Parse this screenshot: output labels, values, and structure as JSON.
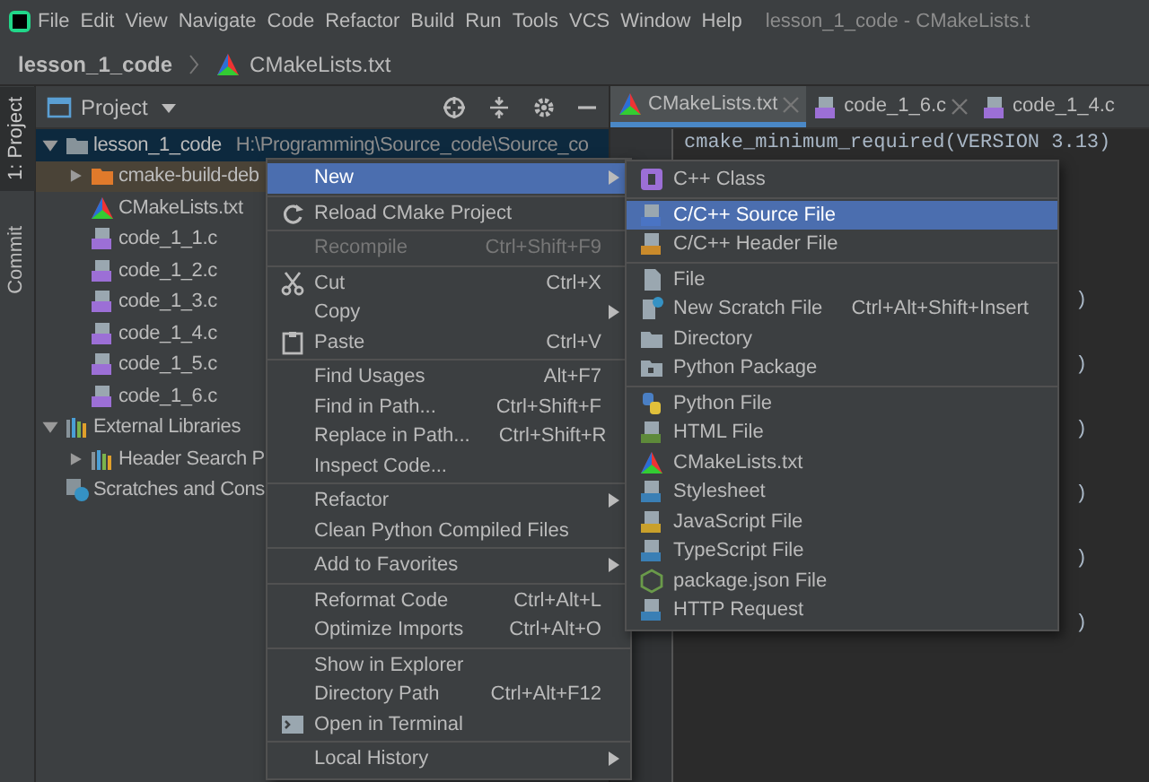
{
  "menu_bar": {
    "items": [
      "File",
      "Edit",
      "View",
      "Navigate",
      "Code",
      "Refactor",
      "Build",
      "Run",
      "Tools",
      "VCS",
      "Window",
      "Help"
    ],
    "title": "lesson_1_code - CMakeLists.t"
  },
  "breadcrumb": {
    "project": "lesson_1_code",
    "file": "CMakeLists.txt"
  },
  "side_strip": {
    "tabs": [
      {
        "label": "1: Project",
        "selected": true
      },
      {
        "label": "Commit",
        "selected": false
      }
    ]
  },
  "project_panel": {
    "title": "Project",
    "tree": [
      {
        "kind": "folder",
        "name": "lesson_1_code",
        "path": "H:\\Programming\\Source_code\\Source_co",
        "expanded": true,
        "selected": true,
        "children": [
          {
            "kind": "excluded-folder",
            "name": "cmake-build-deb",
            "expanded": false,
            "selected": false
          },
          {
            "kind": "cmake",
            "name": "CMakeLists.txt",
            "selected": false
          },
          {
            "kind": "c-file",
            "name": "code_1_1.c",
            "selected": false
          },
          {
            "kind": "c-file",
            "name": "code_1_2.c",
            "selected": false
          },
          {
            "kind": "c-file",
            "name": "code_1_3.c",
            "selected": false
          },
          {
            "kind": "c-file",
            "name": "code_1_4.c",
            "selected": false
          },
          {
            "kind": "c-file",
            "name": "code_1_5.c",
            "selected": false
          },
          {
            "kind": "c-file",
            "name": "code_1_6.c",
            "selected": false
          }
        ]
      },
      {
        "kind": "library",
        "name": "External Libraries",
        "expanded": true,
        "selected": false,
        "children": [
          {
            "kind": "library",
            "name": "Header Search P",
            "expanded": false,
            "selected": false
          }
        ]
      },
      {
        "kind": "scratches",
        "name": "Scratches and Cons",
        "selected": false
      }
    ]
  },
  "editor": {
    "tabs": [
      {
        "kind": "cmake",
        "label": "CMakeLists.txt",
        "selected": true
      },
      {
        "kind": "c-file",
        "label": "code_1_6.c",
        "selected": false
      },
      {
        "kind": "c-file",
        "label": "code_1_4.c",
        "selected": false
      }
    ],
    "first_line": "cmake_minimum_required(VERSION 3.13)",
    "line_fragments": [
      ")",
      ")",
      ")",
      ")",
      ")",
      ")"
    ]
  },
  "context_menu": {
    "groups": [
      [
        {
          "label": "New",
          "submenu": true,
          "selected": true,
          "disabled": false
        }
      ],
      [
        {
          "label": "Reload CMake Project",
          "submenu": false,
          "selected": false,
          "disabled": false
        }
      ],
      [
        {
          "label": "Recompile",
          "shortcut": "Ctrl+Shift+F9",
          "submenu": false,
          "selected": false,
          "disabled": true
        }
      ],
      [
        {
          "label": "Cut",
          "shortcut": "Ctrl+X",
          "submenu": false,
          "selected": false,
          "disabled": false
        },
        {
          "label": "Copy",
          "submenu": true,
          "selected": false,
          "disabled": false
        },
        {
          "label": "Paste",
          "shortcut": "Ctrl+V",
          "submenu": false,
          "selected": false,
          "disabled": false
        }
      ],
      [
        {
          "label": "Find Usages",
          "shortcut": "Alt+F7",
          "submenu": false,
          "selected": false,
          "disabled": false
        },
        {
          "label": "Find in Path...",
          "shortcut": "Ctrl+Shift+F",
          "submenu": false,
          "selected": false,
          "disabled": false
        },
        {
          "label": "Replace in Path...",
          "shortcut": "Ctrl+Shift+R",
          "submenu": false,
          "selected": false,
          "disabled": false
        },
        {
          "label": "Inspect Code...",
          "submenu": false,
          "selected": false,
          "disabled": false
        }
      ],
      [
        {
          "label": "Refactor",
          "submenu": true,
          "selected": false,
          "disabled": false
        },
        {
          "label": "Clean Python Compiled Files",
          "submenu": false,
          "selected": false,
          "disabled": false
        }
      ],
      [
        {
          "label": "Add to Favorites",
          "submenu": true,
          "selected": false,
          "disabled": false
        }
      ],
      [
        {
          "label": "Reformat Code",
          "shortcut": "Ctrl+Alt+L",
          "submenu": false,
          "selected": false,
          "disabled": false
        },
        {
          "label": "Optimize Imports",
          "shortcut": "Ctrl+Alt+O",
          "submenu": false,
          "selected": false,
          "disabled": false
        }
      ],
      [
        {
          "label": "Show in Explorer",
          "submenu": false,
          "selected": false,
          "disabled": false
        },
        {
          "label": "Directory Path",
          "shortcut": "Ctrl+Alt+F12",
          "submenu": false,
          "selected": false,
          "disabled": false
        },
        {
          "label": "Open in Terminal",
          "submenu": false,
          "selected": false,
          "disabled": false
        }
      ],
      [
        {
          "label": "Local History",
          "submenu": true,
          "selected": false,
          "disabled": false
        }
      ]
    ]
  },
  "new_submenu": {
    "groups": [
      [
        {
          "label": "C++ Class",
          "selected": false
        }
      ],
      [
        {
          "label": "C/C++ Source File",
          "selected": true
        },
        {
          "label": "C/C++ Header File",
          "selected": false
        }
      ],
      [
        {
          "label": "File",
          "selected": false
        },
        {
          "label": "New Scratch File",
          "shortcut": "Ctrl+Alt+Shift+Insert",
          "selected": false
        },
        {
          "label": "Directory",
          "selected": false
        },
        {
          "label": "Python Package",
          "selected": false
        }
      ],
      [
        {
          "label": "Python File",
          "selected": false
        },
        {
          "label": "HTML File",
          "selected": false
        },
        {
          "label": "CMakeLists.txt",
          "selected": false
        },
        {
          "label": "Stylesheet",
          "selected": false
        },
        {
          "label": "JavaScript File",
          "selected": false
        },
        {
          "label": "TypeScript File",
          "selected": false
        },
        {
          "label": "package.json File",
          "selected": false
        },
        {
          "label": "HTTP Request",
          "selected": false
        }
      ]
    ]
  }
}
